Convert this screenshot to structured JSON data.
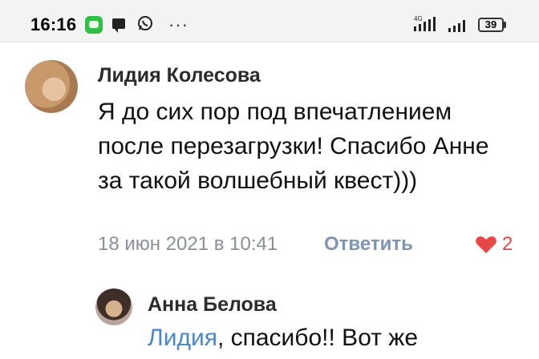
{
  "status_bar": {
    "time": "16:16",
    "network_label": "4G",
    "battery": "39",
    "overflow": "···",
    "icons": [
      "app-icon",
      "message-icon",
      "whatsapp-icon",
      "overflow-icon",
      "signal-icon",
      "signal-icon",
      "battery-icon"
    ]
  },
  "comment": {
    "author": "Лидия Колесова",
    "text": "Я до сих пор под впечатлением после перезагрузки! Спасибо Анне за такой волшебный квест)))",
    "date": "18 июн 2021 в 10:41",
    "reply_label": "Ответить",
    "likes": "2",
    "like_color": "#e64646"
  },
  "reply": {
    "author": "Анна Белова",
    "mention": "Лидия",
    "text_rest": ", спасибо!! Вот же",
    "mention_color": "#4a86c8"
  }
}
